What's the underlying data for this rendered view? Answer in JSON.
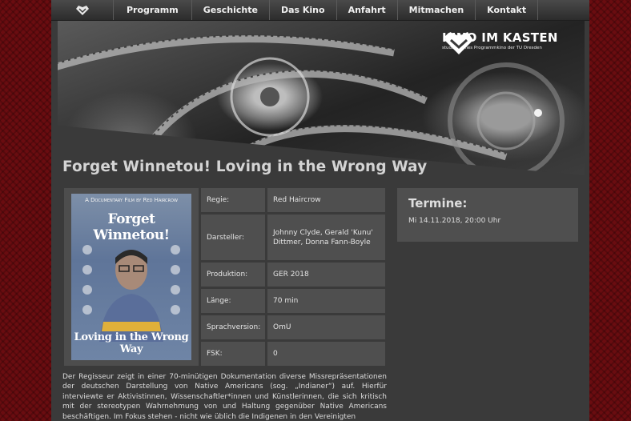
{
  "nav": {
    "items": [
      "Programm",
      "Geschichte",
      "Das Kino",
      "Anfahrt",
      "Mitmachen",
      "Kontakt"
    ]
  },
  "logo": {
    "title": "KINO IM KASTEN",
    "subtitle": "studentisches Programmkino der TU Dresden"
  },
  "film": {
    "title": "Forget Winnetou! Loving in the Wrong Way",
    "poster": {
      "caption": "A Documentary Film by Red Haircrow",
      "title_line": "Forget Winnetou!",
      "bottom_line": "Loving in the Wrong Way"
    },
    "details": [
      {
        "label": "Regie:",
        "value": "Red Haircrow"
      },
      {
        "label": "Darsteller:",
        "value": "Johnny Clyde, Gerald 'Kunu' Dittmer, Donna Fann-Boyle"
      },
      {
        "label": "Produktion:",
        "value": "GER 2018"
      },
      {
        "label": "Länge:",
        "value": "70 min"
      },
      {
        "label": "Sprachversion:",
        "value": "OmU"
      },
      {
        "label": "FSK:",
        "value": "0"
      }
    ],
    "description": "Der Regisseur zeigt in einer 70-minütigen Dokumentation diverse Missrepräsentationen der deutschen Darstellung von Native Americans (sog. „Indianer“) auf. Hierfür interviewte er Aktivistinnen, Wissenschaftler*innen und Künstlerinnen, die sich kritisch mit der stereotypen Wahrnehmung von und Haltung gegenüber Native Americans beschäftigen. Im Fokus stehen - nicht wie üblich die Indigenen in den Vereinigten"
  },
  "termine": {
    "title": "Termine:",
    "date": "Mi 14.11.2018, 20:00 Uhr"
  }
}
